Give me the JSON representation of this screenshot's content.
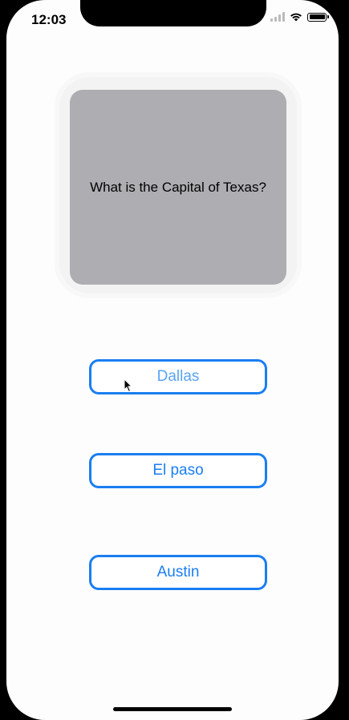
{
  "status_bar": {
    "time": "12:03"
  },
  "quiz": {
    "question": "What is the Capital of Texas?",
    "answers": [
      "Dallas",
      "El paso",
      "Austin"
    ]
  },
  "colors": {
    "accent": "#1a7ef2",
    "card": "#aeadb2"
  }
}
